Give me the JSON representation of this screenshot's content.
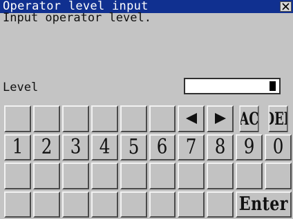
{
  "window": {
    "title": "Operator level input",
    "close_icon": "close-x-icon"
  },
  "instruction": "Input operator level.",
  "level": {
    "label": "Level",
    "value": ""
  },
  "keypad": {
    "row1": {
      "left_arrow_icon": "left-arrow-icon",
      "right_arrow_icon": "right-arrow-icon",
      "ac_label": "AC",
      "del_label": "DEL"
    },
    "digits": [
      "1",
      "2",
      "3",
      "4",
      "5",
      "6",
      "7",
      "8",
      "9",
      "0"
    ],
    "enter_label": "Enter"
  },
  "colors": {
    "titlebar": "#103090",
    "background": "#c4c4c4",
    "key_face": "#c2c2c2"
  }
}
